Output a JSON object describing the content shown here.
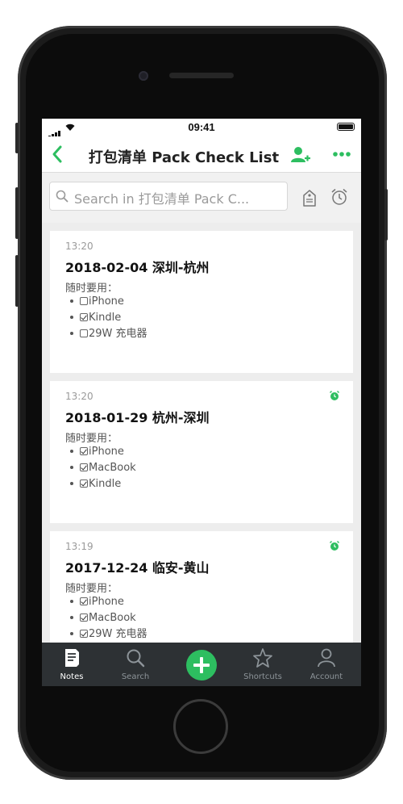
{
  "status_bar": {
    "time": "09:41"
  },
  "nav": {
    "title": "打包清单 Pack Check List"
  },
  "search": {
    "placeholder": "Search in 打包清单 Pack C..."
  },
  "notes": [
    {
      "time": "13:20",
      "title": "2018-02-04 深圳-杭州",
      "subtitle": "随时要用：",
      "has_reminder": false,
      "items": [
        {
          "label": "iPhone",
          "checked": false
        },
        {
          "label": "Kindle",
          "checked": true
        },
        {
          "label": "29W 充电器",
          "checked": false
        }
      ]
    },
    {
      "time": "13:20",
      "title": "2018-01-29 杭州-深圳",
      "subtitle": "随时要用：",
      "has_reminder": true,
      "items": [
        {
          "label": "iPhone",
          "checked": true
        },
        {
          "label": "MacBook",
          "checked": true
        },
        {
          "label": "Kindle",
          "checked": true
        }
      ]
    },
    {
      "time": "13:19",
      "title": "2017-12-24 临安-黄山",
      "subtitle": "随时要用：",
      "has_reminder": true,
      "items": [
        {
          "label": "iPhone",
          "checked": true
        },
        {
          "label": "MacBook",
          "checked": true
        },
        {
          "label": "29W 充电器",
          "checked": true
        }
      ]
    }
  ],
  "tabbar": {
    "notes": "Notes",
    "search": "Search",
    "shortcuts": "Shortcuts",
    "account": "Account"
  },
  "colors": {
    "accent": "#2dbe60",
    "tabbar_bg": "#2d3134",
    "screen_bg": "#ededed"
  },
  "icons": [
    "back-icon",
    "add-user-icon",
    "more-icon",
    "search-icon",
    "tag-icon",
    "alarm-icon",
    "notes-icon",
    "star-icon",
    "account-icon",
    "plus-icon"
  ]
}
